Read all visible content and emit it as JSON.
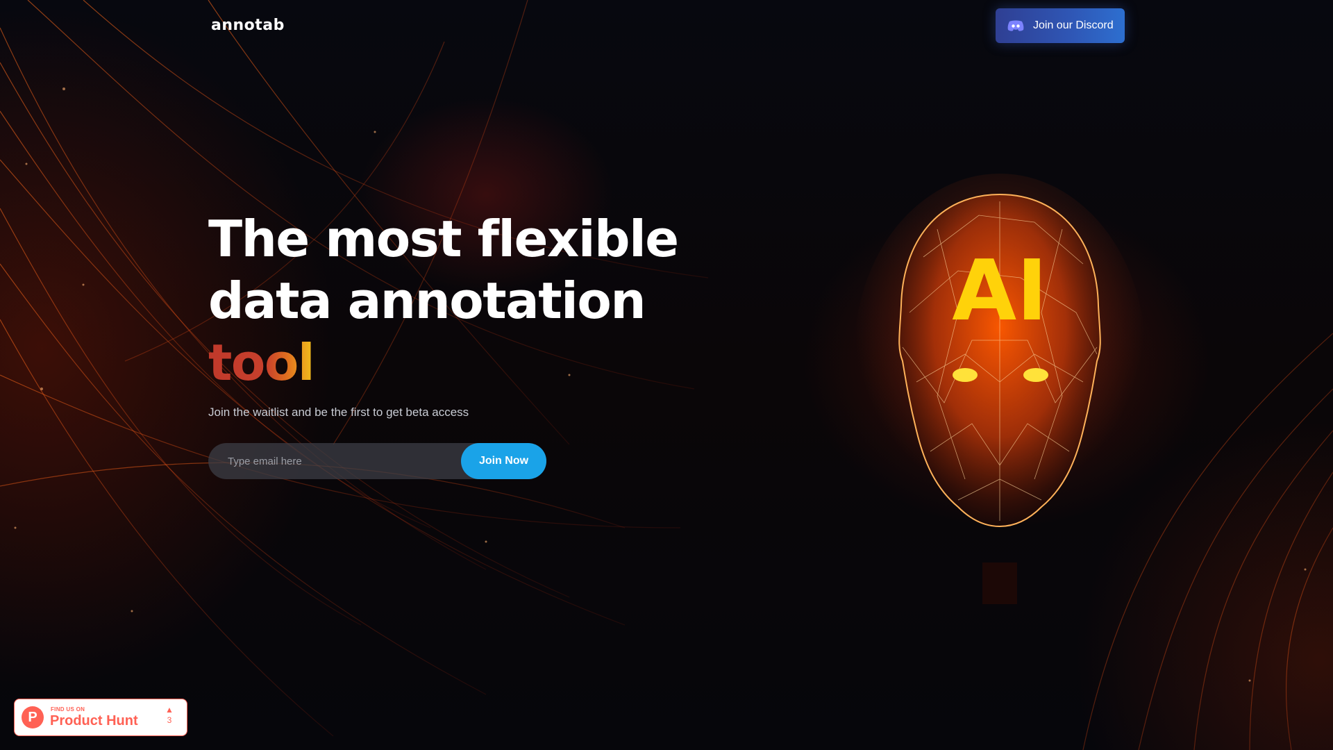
{
  "header": {
    "logo": "annotab",
    "discord_button": "Join our Discord",
    "discord_icon": "discord-icon"
  },
  "hero": {
    "headline_line1": "The most flexible",
    "headline_line2": "data annotation",
    "headline_accent": "tool",
    "subtitle": "Join the waitlist and be the first to get beta access",
    "email_placeholder": "Type email here",
    "email_value": "",
    "join_button": "Join Now"
  },
  "illustration": {
    "head_label": "AI"
  },
  "product_hunt": {
    "small_text": "FIND US ON",
    "big_text": "Product Hunt",
    "logo_letter": "P",
    "upvote_icon": "upvote-arrow-icon",
    "upvote_count": "3"
  },
  "colors": {
    "accent_blue": "#1aa3e8",
    "discord_blue": "#2f57b6",
    "product_hunt": "#ff6154",
    "gradient_red": "#c0392b",
    "gradient_yellow": "#f2c21c"
  }
}
